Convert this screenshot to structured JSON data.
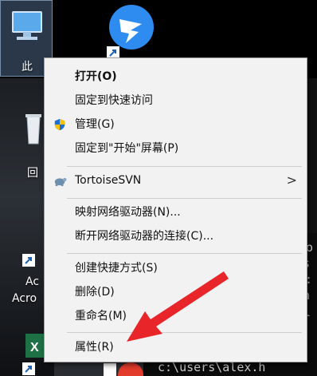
{
  "desktop": {
    "labels": [
      {
        "id": "pc",
        "text": "此"
      },
      {
        "id": "recycle",
        "text": "回"
      },
      {
        "id": "acro1",
        "text": "Ac"
      },
      {
        "id": "acro2",
        "text": "Acro"
      }
    ]
  },
  "terminal": {
    "lines": [
      "lo",
      "s",
      ":",
      "n",
      "r",
      "c:\\users\\alex.h"
    ]
  },
  "menu": {
    "items": [
      {
        "label": "打开(O)",
        "bold": true
      },
      {
        "label": "固定到快速访问"
      },
      {
        "label": "管理(G)",
        "icon": "shield-icon"
      },
      {
        "label": "固定到\"开始\"屏幕(P)"
      },
      {
        "label": "TortoiseSVN",
        "icon": "tortoise-icon",
        "submenu": true
      },
      {
        "label": "映射网络驱动器(N)..."
      },
      {
        "label": "断开网络驱动器的连接(C)..."
      },
      {
        "label": "创建快捷方式(S)"
      },
      {
        "label": "删除(D)"
      },
      {
        "label": "重命名(M)"
      },
      {
        "label": "属性(R)"
      }
    ],
    "submenu_glyph": ">"
  },
  "colors": {
    "menu_bg": "#f2f2f2",
    "arrow": "#e8262a",
    "shield_blue": "#1f6fd1",
    "shield_yellow": "#f4c20d"
  }
}
